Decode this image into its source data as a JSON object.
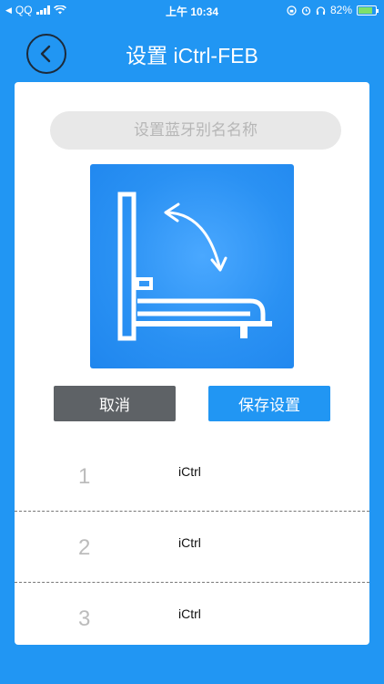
{
  "status_bar": {
    "back_label": "◀",
    "carrier": "QQ",
    "time": "上午 10:34",
    "battery": "82%",
    "battery_level": 0.82
  },
  "header": {
    "title": "设置 iCtrl-FEB"
  },
  "alias_input": {
    "placeholder": "设置蓝牙别名名称",
    "value": ""
  },
  "buttons": {
    "cancel_label": "取消",
    "save_label": "保存设置"
  },
  "profiles": [
    {
      "number": "1",
      "name": "iCtrl"
    },
    {
      "number": "2",
      "name": "iCtrl"
    },
    {
      "number": "3",
      "name": "iCtrl"
    }
  ],
  "colors": {
    "background": "#2196f3",
    "cancel_button": "#5e6266",
    "save_button": "#2196f3"
  }
}
